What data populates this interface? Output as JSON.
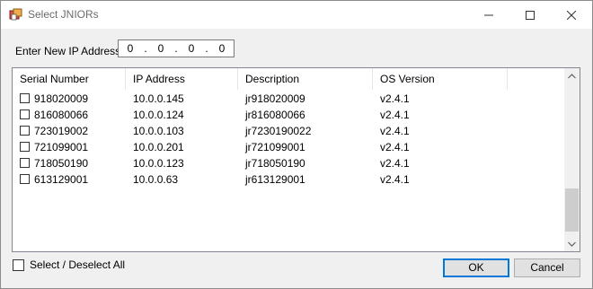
{
  "window": {
    "title": "Select JNIORs"
  },
  "ip_entry": {
    "label": "Enter New IP Address",
    "octets": [
      "0",
      "0",
      "0",
      "0"
    ],
    "separator": "."
  },
  "table": {
    "columns": [
      "Serial Number",
      "IP Address",
      "Description",
      "OS Version"
    ],
    "rows": [
      {
        "serial": "918020009",
        "ip": "10.0.0.145",
        "description": "jr918020009",
        "os": "v2.4.1"
      },
      {
        "serial": "816080066",
        "ip": "10.0.0.124",
        "description": "jr816080066",
        "os": "v2.4.1"
      },
      {
        "serial": "723019002",
        "ip": "10.0.0.103",
        "description": "jr7230190022",
        "os": "v2.4.1"
      },
      {
        "serial": "721099001",
        "ip": "10.0.0.201",
        "description": "jr721099001",
        "os": "v2.4.1"
      },
      {
        "serial": "718050190",
        "ip": "10.0.0.123",
        "description": "jr718050190",
        "os": "v2.4.1"
      },
      {
        "serial": "613129001",
        "ip": "10.0.0.63",
        "description": "jr613129001",
        "os": "v2.4.1"
      }
    ]
  },
  "select_all": {
    "label": "Select / Deselect All",
    "checked": false
  },
  "buttons": {
    "ok": "OK",
    "cancel": "Cancel"
  },
  "colors": {
    "accent": "#0078d7",
    "dialog_bg": "#f0f0f0",
    "list_bg": "#ffffff"
  },
  "icons": [
    "app-icon",
    "minimize-icon",
    "maximize-icon",
    "close-icon",
    "scroll-up-icon",
    "scroll-down-icon"
  ]
}
